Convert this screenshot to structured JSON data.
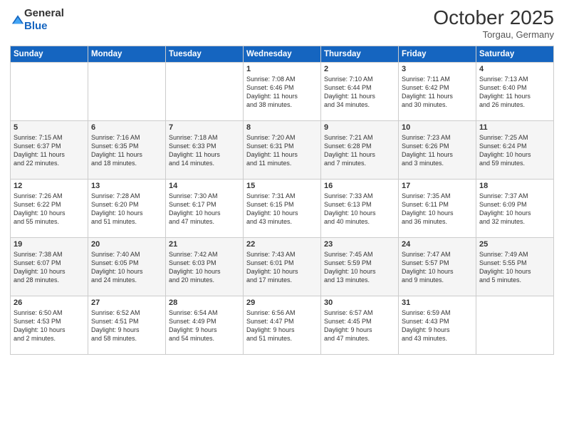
{
  "logo": {
    "text_general": "General",
    "text_blue": "Blue"
  },
  "header": {
    "month": "October 2025",
    "location": "Torgau, Germany"
  },
  "weekdays": [
    "Sunday",
    "Monday",
    "Tuesday",
    "Wednesday",
    "Thursday",
    "Friday",
    "Saturday"
  ],
  "weeks": [
    [
      {
        "day": "",
        "info": ""
      },
      {
        "day": "",
        "info": ""
      },
      {
        "day": "",
        "info": ""
      },
      {
        "day": "1",
        "info": "Sunrise: 7:08 AM\nSunset: 6:46 PM\nDaylight: 11 hours\nand 38 minutes."
      },
      {
        "day": "2",
        "info": "Sunrise: 7:10 AM\nSunset: 6:44 PM\nDaylight: 11 hours\nand 34 minutes."
      },
      {
        "day": "3",
        "info": "Sunrise: 7:11 AM\nSunset: 6:42 PM\nDaylight: 11 hours\nand 30 minutes."
      },
      {
        "day": "4",
        "info": "Sunrise: 7:13 AM\nSunset: 6:40 PM\nDaylight: 11 hours\nand 26 minutes."
      }
    ],
    [
      {
        "day": "5",
        "info": "Sunrise: 7:15 AM\nSunset: 6:37 PM\nDaylight: 11 hours\nand 22 minutes."
      },
      {
        "day": "6",
        "info": "Sunrise: 7:16 AM\nSunset: 6:35 PM\nDaylight: 11 hours\nand 18 minutes."
      },
      {
        "day": "7",
        "info": "Sunrise: 7:18 AM\nSunset: 6:33 PM\nDaylight: 11 hours\nand 14 minutes."
      },
      {
        "day": "8",
        "info": "Sunrise: 7:20 AM\nSunset: 6:31 PM\nDaylight: 11 hours\nand 11 minutes."
      },
      {
        "day": "9",
        "info": "Sunrise: 7:21 AM\nSunset: 6:28 PM\nDaylight: 11 hours\nand 7 minutes."
      },
      {
        "day": "10",
        "info": "Sunrise: 7:23 AM\nSunset: 6:26 PM\nDaylight: 11 hours\nand 3 minutes."
      },
      {
        "day": "11",
        "info": "Sunrise: 7:25 AM\nSunset: 6:24 PM\nDaylight: 10 hours\nand 59 minutes."
      }
    ],
    [
      {
        "day": "12",
        "info": "Sunrise: 7:26 AM\nSunset: 6:22 PM\nDaylight: 10 hours\nand 55 minutes."
      },
      {
        "day": "13",
        "info": "Sunrise: 7:28 AM\nSunset: 6:20 PM\nDaylight: 10 hours\nand 51 minutes."
      },
      {
        "day": "14",
        "info": "Sunrise: 7:30 AM\nSunset: 6:17 PM\nDaylight: 10 hours\nand 47 minutes."
      },
      {
        "day": "15",
        "info": "Sunrise: 7:31 AM\nSunset: 6:15 PM\nDaylight: 10 hours\nand 43 minutes."
      },
      {
        "day": "16",
        "info": "Sunrise: 7:33 AM\nSunset: 6:13 PM\nDaylight: 10 hours\nand 40 minutes."
      },
      {
        "day": "17",
        "info": "Sunrise: 7:35 AM\nSunset: 6:11 PM\nDaylight: 10 hours\nand 36 minutes."
      },
      {
        "day": "18",
        "info": "Sunrise: 7:37 AM\nSunset: 6:09 PM\nDaylight: 10 hours\nand 32 minutes."
      }
    ],
    [
      {
        "day": "19",
        "info": "Sunrise: 7:38 AM\nSunset: 6:07 PM\nDaylight: 10 hours\nand 28 minutes."
      },
      {
        "day": "20",
        "info": "Sunrise: 7:40 AM\nSunset: 6:05 PM\nDaylight: 10 hours\nand 24 minutes."
      },
      {
        "day": "21",
        "info": "Sunrise: 7:42 AM\nSunset: 6:03 PM\nDaylight: 10 hours\nand 20 minutes."
      },
      {
        "day": "22",
        "info": "Sunrise: 7:43 AM\nSunset: 6:01 PM\nDaylight: 10 hours\nand 17 minutes."
      },
      {
        "day": "23",
        "info": "Sunrise: 7:45 AM\nSunset: 5:59 PM\nDaylight: 10 hours\nand 13 minutes."
      },
      {
        "day": "24",
        "info": "Sunrise: 7:47 AM\nSunset: 5:57 PM\nDaylight: 10 hours\nand 9 minutes."
      },
      {
        "day": "25",
        "info": "Sunrise: 7:49 AM\nSunset: 5:55 PM\nDaylight: 10 hours\nand 5 minutes."
      }
    ],
    [
      {
        "day": "26",
        "info": "Sunrise: 6:50 AM\nSunset: 4:53 PM\nDaylight: 10 hours\nand 2 minutes."
      },
      {
        "day": "27",
        "info": "Sunrise: 6:52 AM\nSunset: 4:51 PM\nDaylight: 9 hours\nand 58 minutes."
      },
      {
        "day": "28",
        "info": "Sunrise: 6:54 AM\nSunset: 4:49 PM\nDaylight: 9 hours\nand 54 minutes."
      },
      {
        "day": "29",
        "info": "Sunrise: 6:56 AM\nSunset: 4:47 PM\nDaylight: 9 hours\nand 51 minutes."
      },
      {
        "day": "30",
        "info": "Sunrise: 6:57 AM\nSunset: 4:45 PM\nDaylight: 9 hours\nand 47 minutes."
      },
      {
        "day": "31",
        "info": "Sunrise: 6:59 AM\nSunset: 4:43 PM\nDaylight: 9 hours\nand 43 minutes."
      },
      {
        "day": "",
        "info": ""
      }
    ]
  ]
}
